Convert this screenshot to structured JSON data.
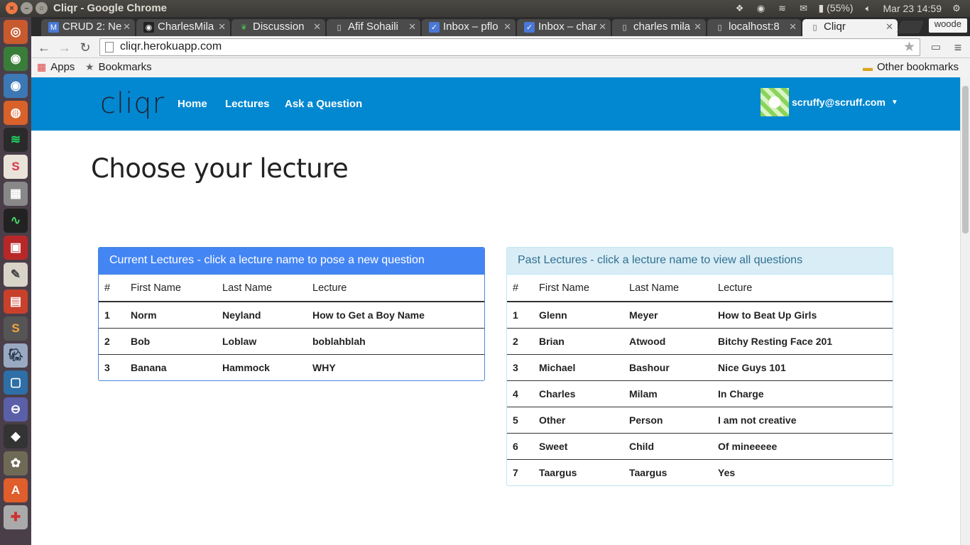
{
  "os": {
    "window_title": "Cliqr - Google Chrome",
    "battery": "(55%)",
    "datetime": "Mar 23 14:59"
  },
  "browser": {
    "tabs": [
      {
        "label": "CRUD 2: Ne",
        "icon": "gmail-icon"
      },
      {
        "label": "CharlesMila",
        "icon": "github-icon"
      },
      {
        "label": "Discussion",
        "icon": "leaf-icon"
      },
      {
        "label": "Afif Sohaili",
        "icon": "page-icon"
      },
      {
        "label": "Inbox – pflo",
        "icon": "inbox-icon"
      },
      {
        "label": "Inbox – char",
        "icon": "inbox-icon"
      },
      {
        "label": "charles mila",
        "icon": "page-icon"
      },
      {
        "label": "localhost:8",
        "icon": "page-icon"
      },
      {
        "label": "Cliqr",
        "icon": "page-icon"
      }
    ],
    "profile": "woode",
    "url": "cliqr.herokuapp.com",
    "bookmarks": {
      "apps": "Apps",
      "bookmarks": "Bookmarks",
      "other": "Other bookmarks"
    }
  },
  "nav": {
    "logo": "cliqr",
    "links": [
      "Home",
      "Lectures",
      "Ask a Question"
    ],
    "user_email": "scruffy@scruff.com"
  },
  "page_title": "Choose your lecture",
  "current_lectures": {
    "heading": "Current Lectures - click a lecture name to pose a new question",
    "columns": [
      "#",
      "First Name",
      "Last Name",
      "Lecture"
    ],
    "rows": [
      [
        "1",
        "Norm",
        "Neyland",
        "How to Get a Boy Name"
      ],
      [
        "2",
        "Bob",
        "Loblaw",
        "boblahblah"
      ],
      [
        "3",
        "Banana",
        "Hammock",
        "WHY"
      ]
    ]
  },
  "past_lectures": {
    "heading": "Past Lectures - click a lecture name to view all questions",
    "columns": [
      "#",
      "First Name",
      "Last Name",
      "Lecture"
    ],
    "rows": [
      [
        "1",
        "Glenn",
        "Meyer",
        "How to Beat Up Girls"
      ],
      [
        "2",
        "Brian",
        "Atwood",
        "Bitchy Resting Face 201"
      ],
      [
        "3",
        "Michael",
        "Bashour",
        "Nice Guys 101"
      ],
      [
        "4",
        "Charles",
        "Milam",
        "In Charge"
      ],
      [
        "5",
        "Other",
        "Person",
        "I am not creative"
      ],
      [
        "6",
        "Sweet",
        "Child",
        "Of mineeeee"
      ],
      [
        "7",
        "Taargus",
        "Taargus",
        "Yes"
      ]
    ]
  },
  "colors": {
    "navbar": "#0288d1",
    "primary_panel": "#4485f4",
    "info_panel": "#d9edf7"
  }
}
